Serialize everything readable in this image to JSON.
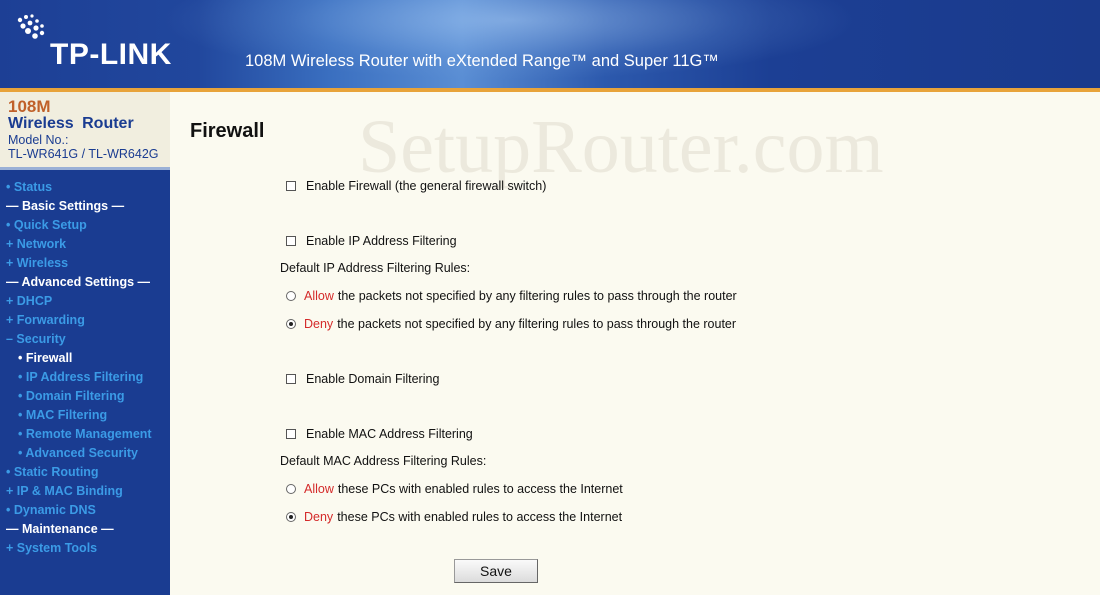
{
  "header": {
    "brand": "TP-LINK",
    "tagline": "108M Wireless Router with eXtended Range™ and Super 11G™"
  },
  "model": {
    "line1": "108M",
    "line2": "Wireless Router",
    "line3": "Model No.:",
    "line4": "TL-WR641G / TL-WR642G"
  },
  "sidebar": {
    "items": [
      {
        "label": "• Status"
      },
      {
        "label": "— Basic Settings —"
      },
      {
        "label": "• Quick Setup"
      },
      {
        "label": "+ Network"
      },
      {
        "label": "+ Wireless"
      },
      {
        "label": "— Advanced Settings —"
      },
      {
        "label": "+ DHCP"
      },
      {
        "label": "+ Forwarding"
      },
      {
        "label": "– Security"
      },
      {
        "label": "• Firewall"
      },
      {
        "label": "• IP Address Filtering"
      },
      {
        "label": "• Domain Filtering"
      },
      {
        "label": "• MAC Filtering"
      },
      {
        "label": "• Remote Management"
      },
      {
        "label": "• Advanced Security"
      },
      {
        "label": "• Static Routing"
      },
      {
        "label": "+ IP & MAC Binding"
      },
      {
        "label": "• Dynamic DNS"
      },
      {
        "label": "— Maintenance —"
      },
      {
        "label": "+ System Tools"
      }
    ]
  },
  "main": {
    "watermark": "SetupRouter.com",
    "title": "Firewall",
    "enable_firewall": {
      "label": "Enable Firewall (the general firewall switch)",
      "checked": false
    },
    "enable_ip_filtering": {
      "label": "Enable IP Address Filtering",
      "checked": false
    },
    "ip_rules_label": "Default IP Address Filtering Rules:",
    "ip_allow": {
      "keyword": "Allow",
      "text": "the packets not specified by any filtering rules to pass through the router",
      "selected": false
    },
    "ip_deny": {
      "keyword": "Deny",
      "text": "the packets not specified by any filtering rules to pass through the router",
      "selected": true
    },
    "enable_domain_filtering": {
      "label": "Enable Domain Filtering",
      "checked": false
    },
    "enable_mac_filtering": {
      "label": "Enable MAC Address Filtering",
      "checked": false
    },
    "mac_rules_label": "Default MAC Address Filtering Rules:",
    "mac_allow": {
      "keyword": "Allow",
      "text": "these PCs with enabled rules to access the Internet",
      "selected": false
    },
    "mac_deny": {
      "keyword": "Deny",
      "text": "these PCs with enabled rules to access the Internet",
      "selected": true
    },
    "save_label": "Save"
  },
  "colors": {
    "header_blue": "#1d3f95",
    "sidebar_blue": "#1a3c91",
    "link_blue": "#3b9be6",
    "accent_orange": "#e8a33a",
    "keyword_red": "#d42a2a",
    "page_bg": "#fbfaf0"
  }
}
